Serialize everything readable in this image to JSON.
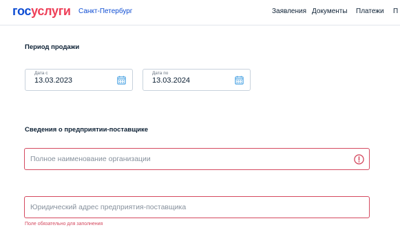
{
  "header": {
    "logo_part1": "гос",
    "logo_part2": "услуги",
    "region": "Санкт-Петербург",
    "nav": [
      "Заявления",
      "Документы",
      "Платежи",
      "П"
    ]
  },
  "sale_period": {
    "title": "Период продажи",
    "date_from": {
      "label": "Дата с",
      "value": "13.03.2023",
      "icon": "calendar-icon"
    },
    "date_to": {
      "label": "Дата по",
      "value": "13.03.2024",
      "icon": "calendar-icon"
    }
  },
  "supplier": {
    "title": "Сведения о предприятии-поставщике",
    "org_name": {
      "placeholder": "Полное наименование организации",
      "icon": "error-icon"
    },
    "legal_address": {
      "placeholder": "Юридический адрес предприятия-поставщика"
    },
    "error_text": "Поле обязательно для заполнения"
  },
  "colors": {
    "brand_blue": "#0d4cd3",
    "brand_red": "#ee3f58",
    "error": "#d4485e",
    "icon_blue": "#3b9be0"
  }
}
